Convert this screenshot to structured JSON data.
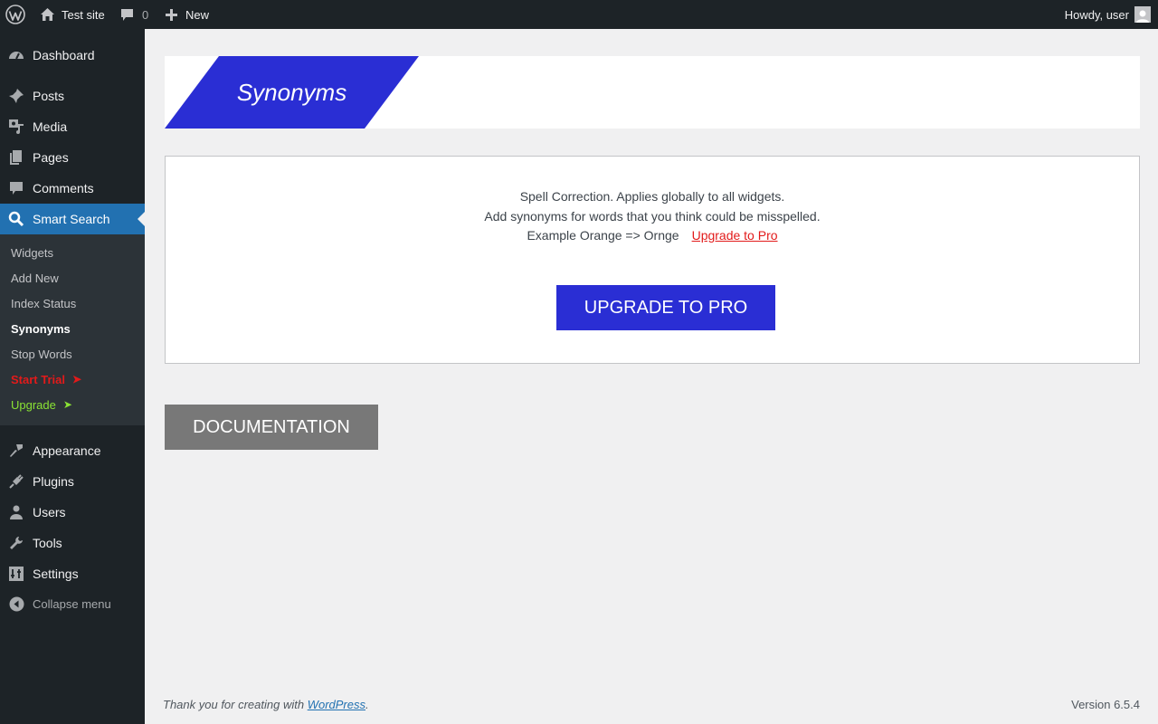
{
  "adminbar": {
    "site_name": "Test site",
    "comments_count": "0",
    "new_label": "New",
    "howdy": "Howdy, user"
  },
  "sidebar": {
    "items": [
      {
        "label": "Dashboard",
        "icon": "dashboard-icon"
      },
      {
        "label": "Posts",
        "icon": "pin-icon"
      },
      {
        "label": "Media",
        "icon": "media-icon"
      },
      {
        "label": "Pages",
        "icon": "pages-icon"
      },
      {
        "label": "Comments",
        "icon": "comment-icon"
      },
      {
        "label": "Smart Search",
        "icon": "search-icon"
      },
      {
        "label": "Appearance",
        "icon": "brush-icon"
      },
      {
        "label": "Plugins",
        "icon": "plugin-icon"
      },
      {
        "label": "Users",
        "icon": "user-icon"
      },
      {
        "label": "Tools",
        "icon": "wrench-icon"
      },
      {
        "label": "Settings",
        "icon": "settings-icon"
      }
    ],
    "submenu": [
      {
        "label": "Widgets"
      },
      {
        "label": "Add New"
      },
      {
        "label": "Index Status"
      },
      {
        "label": "Synonyms"
      },
      {
        "label": "Stop Words"
      },
      {
        "label": "Start Trial"
      },
      {
        "label": "Upgrade"
      }
    ],
    "collapse_label": "Collapse menu"
  },
  "main": {
    "title": "Synonyms",
    "panel": {
      "line1": "Spell Correction. Applies globally to all widgets.",
      "line2": "Add synonyms for words that you think could be misspelled.",
      "line3": "Example Orange => Ornge",
      "link": "Upgrade to Pro",
      "button": "UPGRADE TO PRO"
    },
    "doc_button": "DOCUMENTATION"
  },
  "footer": {
    "thanks": "Thank you for creating with",
    "link": "WordPress",
    "period": ".",
    "version": "Version 6.5.4"
  },
  "colors": {
    "accent": "#2a2ed4",
    "admin_bg": "#1d2327",
    "current_menu": "#2271b1",
    "trial_red": "#e21a1a",
    "upgrade_green": "#8ae234"
  }
}
